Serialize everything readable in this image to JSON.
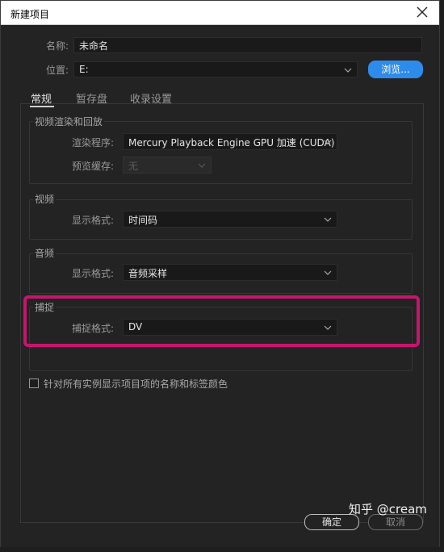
{
  "window": {
    "title": "新建项目"
  },
  "name_row": {
    "label": "名称:",
    "value": "未命名"
  },
  "location_row": {
    "label": "位置:",
    "value": "E:",
    "browse_label": "浏览..."
  },
  "tabs": [
    {
      "label": "常规",
      "active": true
    },
    {
      "label": "暂存盘",
      "active": false
    },
    {
      "label": "收录设置",
      "active": false
    }
  ],
  "video_rendering": {
    "group_label": "视频渲染和回放",
    "renderer_label": "渲染程序:",
    "renderer_value": "Mercury Playback Engine GPU 加速 (CUDA)",
    "preview_cache_label": "预览缓存:",
    "preview_cache_value": "无"
  },
  "video": {
    "group_label": "视频",
    "display_format_label": "显示格式:",
    "display_format_value": "时间码"
  },
  "audio": {
    "group_label": "音频",
    "display_format_label": "显示格式:",
    "display_format_value": "音频采样"
  },
  "capture": {
    "group_label": "捕捉",
    "capture_format_label": "捕捉格式:",
    "capture_format_value": "DV"
  },
  "checkbox_label": "针对所有实例显示项目项的名称和标签颜色",
  "buttons": {
    "ok": "确定",
    "cancel": "取消"
  },
  "watermark": "知乎 @cream",
  "colors": {
    "accent_blue": "#2d8ceb",
    "highlight": "#c8146e",
    "background": "#232323"
  }
}
